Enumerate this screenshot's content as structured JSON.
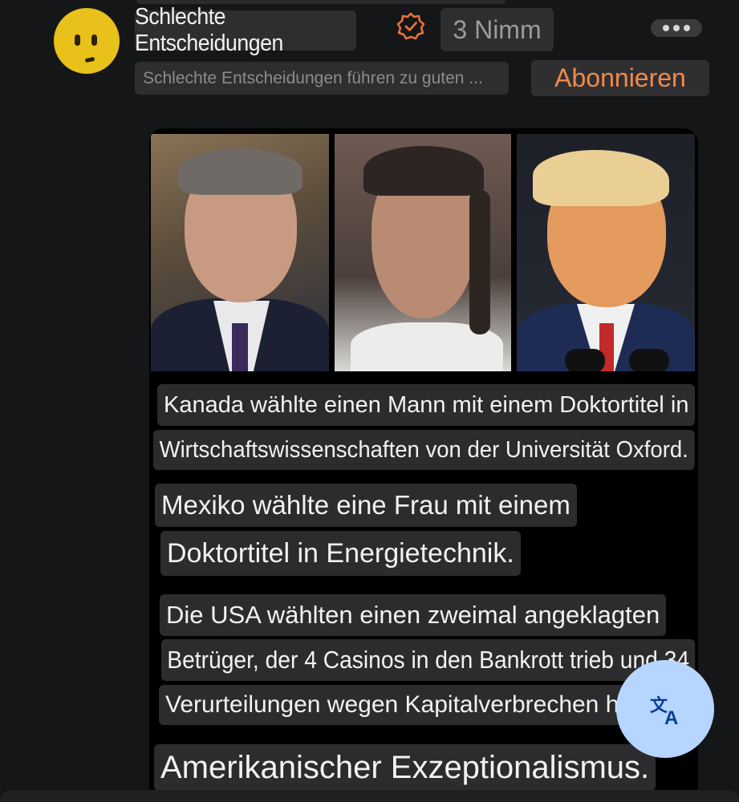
{
  "channel": {
    "name": "Schlechte Entscheidungen",
    "take_label": "3 Nimm",
    "description": "Schlechte Entscheidungen führen zu guten ...",
    "subscribe_label": "Abonnieren",
    "avatar_icon": "neutral-face-emoji",
    "verified_icon": "verified-badge-icon",
    "more_icon": "more-horizontal-icon",
    "accent_color": "#f08a4b"
  },
  "post": {
    "photos": [
      {
        "icon": "man-portrait"
      },
      {
        "icon": "woman-portrait"
      },
      {
        "icon": "man-portrait-smirking"
      }
    ],
    "caption_lines": [
      "Kanada wählte einen Mann mit einem Doktortitel in",
      "Wirtschaftswissenschaften von der Universität Oxford.",
      "Mexiko wählte eine Frau mit einem",
      "Doktortitel in Energietechnik.",
      "Die USA wählten einen zweimal angeklagten",
      "Betrüger, der 4 Casinos in den Bankrott trieb und 34",
      "Verurteilungen wegen Kapitalverbrechen hat.",
      "Amerikanischer Exzeptionalismus."
    ]
  },
  "translate_button": {
    "icon": "translate-icon",
    "color": "#b6d6ff"
  }
}
